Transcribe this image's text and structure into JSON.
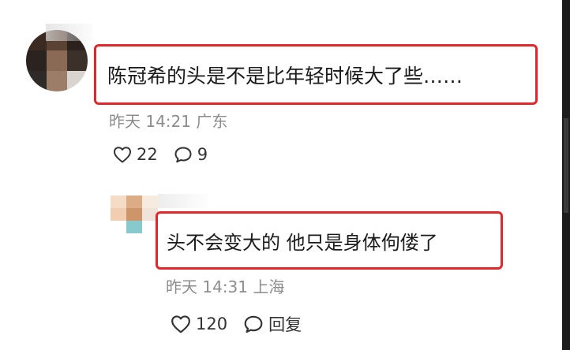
{
  "comments": [
    {
      "text": "陈冠希的头是不是比年轻时候大了些……",
      "time": "昨天 14:21",
      "location": "广东",
      "likes": "22",
      "replies": "9"
    },
    {
      "text": "头不会变大的 他只是身体佝偻了",
      "time": "昨天 14:31",
      "location": "上海",
      "likes": "120",
      "reply_label": "回复"
    }
  ],
  "icons": {
    "like": "heart-outline-icon",
    "comment": "speech-bubble-icon"
  },
  "colors": {
    "highlight_border": "#e3262b",
    "meta_text": "#8c8c8c",
    "body_text": "#1a1a1a"
  }
}
